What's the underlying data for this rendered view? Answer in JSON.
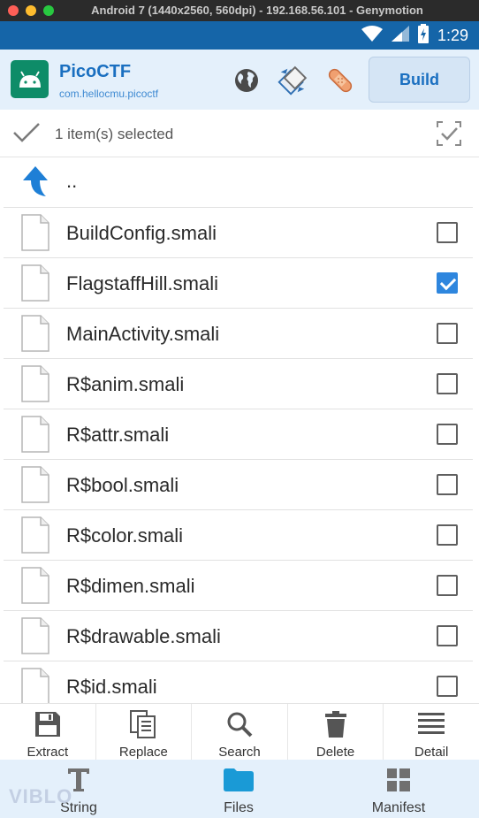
{
  "window": {
    "title": "Android 7 (1440x2560, 560dpi) - 192.168.56.101 - Genymotion"
  },
  "statusbar": {
    "time": "1:29"
  },
  "app": {
    "name": "PicoCTF",
    "package": "com.hellocmu.picoctf",
    "build_label": "Build",
    "header_icons": [
      "globe-icon",
      "compare-icon",
      "patch-icon"
    ]
  },
  "selection": {
    "text": "1 item(s) selected"
  },
  "files": {
    "up_label": "..",
    "items": [
      {
        "name": "BuildConfig.smali",
        "checked": false
      },
      {
        "name": "FlagstaffHill.smali",
        "checked": true
      },
      {
        "name": "MainActivity.smali",
        "checked": false
      },
      {
        "name": "R$anim.smali",
        "checked": false
      },
      {
        "name": "R$attr.smali",
        "checked": false
      },
      {
        "name": "R$bool.smali",
        "checked": false
      },
      {
        "name": "R$color.smali",
        "checked": false
      },
      {
        "name": "R$dimen.smali",
        "checked": false
      },
      {
        "name": "R$drawable.smali",
        "checked": false
      },
      {
        "name": "R$id.smali",
        "checked": false
      }
    ]
  },
  "toolbar": {
    "extract": "Extract",
    "replace": "Replace",
    "search": "Search",
    "delete": "Delete",
    "detail": "Detail"
  },
  "nav": {
    "string": "String",
    "files": "Files",
    "manifest": "Manifest"
  },
  "watermark": "VIBLO",
  "colors": {
    "accent": "#1a6fc0",
    "statusbar": "#1565a8",
    "header_bg": "#e4f0fb",
    "checkbox_checked": "#2e86de",
    "files_nav_icon": "#1a9ad6"
  }
}
